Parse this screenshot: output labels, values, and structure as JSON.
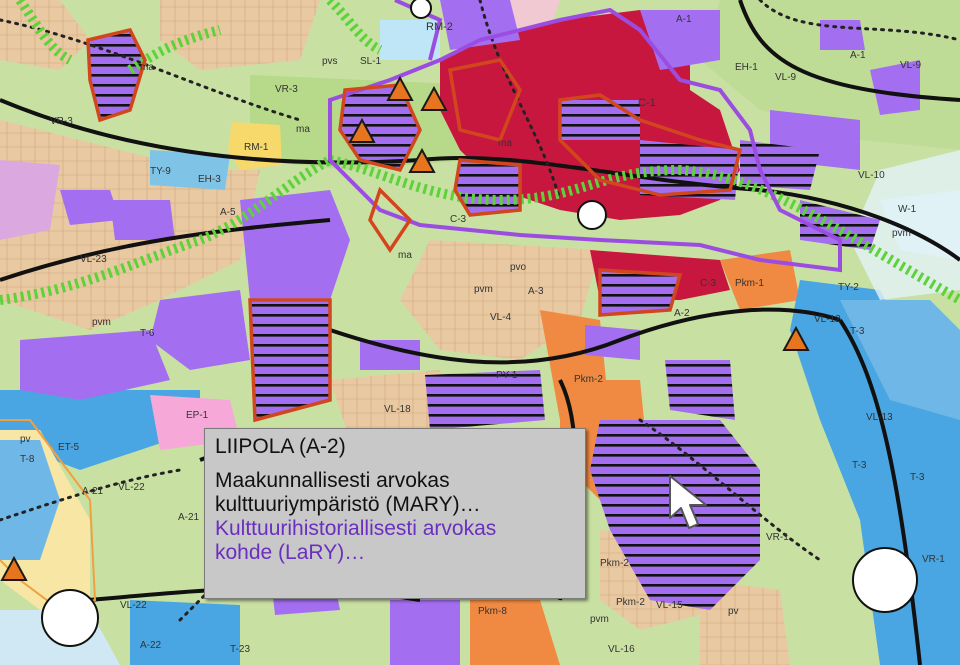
{
  "map": {
    "zone_labels": [
      "RM-2",
      "A-1",
      "A-1",
      "EH-1",
      "VL-9",
      "VL-9",
      "SL-1",
      "ma",
      "pvs",
      "VR-3",
      "VR-3",
      "ma",
      "RM-1",
      "TY-9",
      "EH-3",
      "A-5",
      "VL-23",
      "pvm",
      "T-6",
      "C-1",
      "C-3",
      "C-3",
      "Pkm-1",
      "A-3",
      "pvo",
      "pvm",
      "VL-4",
      "A-2",
      "PY-1",
      "Pkm-2",
      "VL-18",
      "EP-1",
      "ET-5",
      "A-21",
      "VL-22",
      "A-21",
      "T-8",
      "pv",
      "VL-22",
      "A-22",
      "T-23",
      "Pkm-8",
      "Pkm-2",
      "Pkm-2",
      "VL-15",
      "VL-16",
      "pv",
      "pvm",
      "VR-1",
      "VR-1",
      "T-3",
      "T-3",
      "VL-13",
      "T-3",
      "VL-12",
      "TY-2",
      "VL-10",
      "W-1",
      "pvm",
      "ma",
      "ma"
    ],
    "accent_colors": {
      "lary_fill": "#a36ff0",
      "mary_outline": "#d2461e",
      "purple_outline": "#9b4de2",
      "center_red": "#c8173f",
      "hatch": "#111111",
      "marker": "#e6751e"
    }
  },
  "popup": {
    "title": "LIIPOLA (A-2)",
    "mary_line1": "Maakunnallisesti arvokas",
    "mary_line2": "kulttuuriympäristö (MARY)…",
    "lary_line1": "Kulttuurihistoriallisesti arvokas",
    "lary_line2": "kohde (LaRY)…"
  },
  "icons": {
    "pointer": "cursor-arrow-icon",
    "marker": "triangle-marker-icon"
  }
}
